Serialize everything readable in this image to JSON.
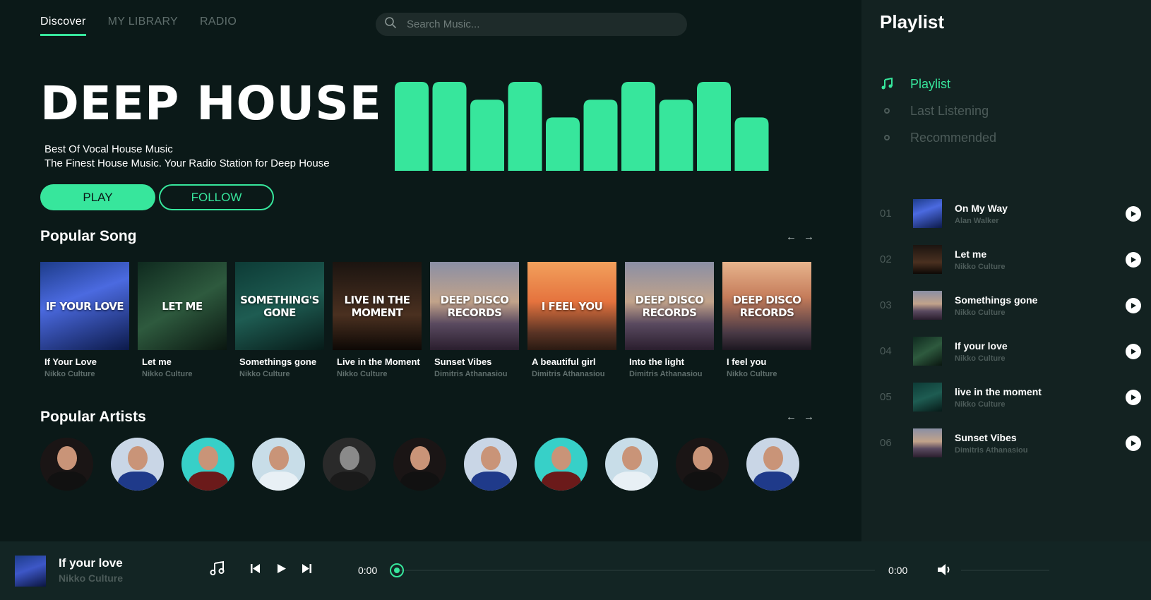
{
  "nav": {
    "tabs": [
      {
        "label": "Discover"
      },
      {
        "label": "MY LIBRARY"
      },
      {
        "label": "RADIO"
      }
    ]
  },
  "search": {
    "placeholder": "Search Music..."
  },
  "hero": {
    "title": "DEEP HOUSE",
    "subtitle_1": "Best Of Vocal House Music",
    "subtitle_2": "The Finest House Music. Your Radio Station for Deep House",
    "play_label": "PLAY",
    "follow_label": "FOLLOW",
    "equalizer_levels": [
      1.0,
      1.0,
      0.8,
      1.0,
      0.6,
      0.8,
      1.0,
      0.8,
      1.0,
      0.6
    ]
  },
  "popular_songs": {
    "title": "Popular Song",
    "prev_arrow": "←",
    "next_arrow": "→",
    "items": [
      {
        "title": "If Your Love",
        "artist": "Nikko Culture",
        "cover_text": "IF YOUR LOVE"
      },
      {
        "title": "Let me",
        "artist": "Nikko Culture",
        "cover_text": "LET ME"
      },
      {
        "title": "Somethings gone",
        "artist": "Nikko Culture",
        "cover_text": "SOMETHING'S GONE"
      },
      {
        "title": "Live in the Moment",
        "artist": "Nikko Culture",
        "cover_text": "LIVE IN THE MOMENT"
      },
      {
        "title": "Sunset Vibes",
        "artist": "Dimitris Athanasiou",
        "cover_text": "DEEP DISCO RECORDS"
      },
      {
        "title": "A beautiful girl",
        "artist": "Dimitris Athanasiou",
        "cover_text": "I FEEL YOU"
      },
      {
        "title": "Into the light",
        "artist": "Dimitris Athanasiou",
        "cover_text": "DEEP DISCO RECORDS"
      },
      {
        "title": "I feel you",
        "artist": "Nikko Culture",
        "cover_text": "DEEP DISCO RECORDS"
      }
    ]
  },
  "popular_artists": {
    "title": "Popular Artists",
    "prev_arrow": "←",
    "next_arrow": "→",
    "count": 11
  },
  "sidebar": {
    "title": "Playlist",
    "menu": [
      {
        "label": "Playlist"
      },
      {
        "label": "Last Listening"
      },
      {
        "label": "Recommended"
      }
    ],
    "tracks": [
      {
        "num": "01",
        "title": "On My Way",
        "artist": "Alan Walker"
      },
      {
        "num": "02",
        "title": "Let me",
        "artist": "Nikko Culture"
      },
      {
        "num": "03",
        "title": "Somethings gone",
        "artist": "Nikko Culture"
      },
      {
        "num": "04",
        "title": "If your love",
        "artist": "Nikko Culture"
      },
      {
        "num": "05",
        "title": "live in the moment",
        "artist": "Nikko Culture"
      },
      {
        "num": "06",
        "title": "Sunset Vibes",
        "artist": "Dimitris Athanasiou"
      }
    ]
  },
  "player": {
    "title": "If your love",
    "artist": "Nikko Culture",
    "current_time": "0:00",
    "total_time": "0:00",
    "progress": 0,
    "volume": 0
  },
  "colors": {
    "accent": "#37e69c",
    "background": "#0b1918",
    "sidebar": "#132221"
  },
  "icons": [
    "search-icon",
    "music-note-icon",
    "circle-bullet-icon",
    "play-circle-icon",
    "skip-back-icon",
    "play-icon",
    "skip-forward-icon",
    "volume-icon",
    "arrow-left-icon",
    "arrow-right-icon"
  ]
}
